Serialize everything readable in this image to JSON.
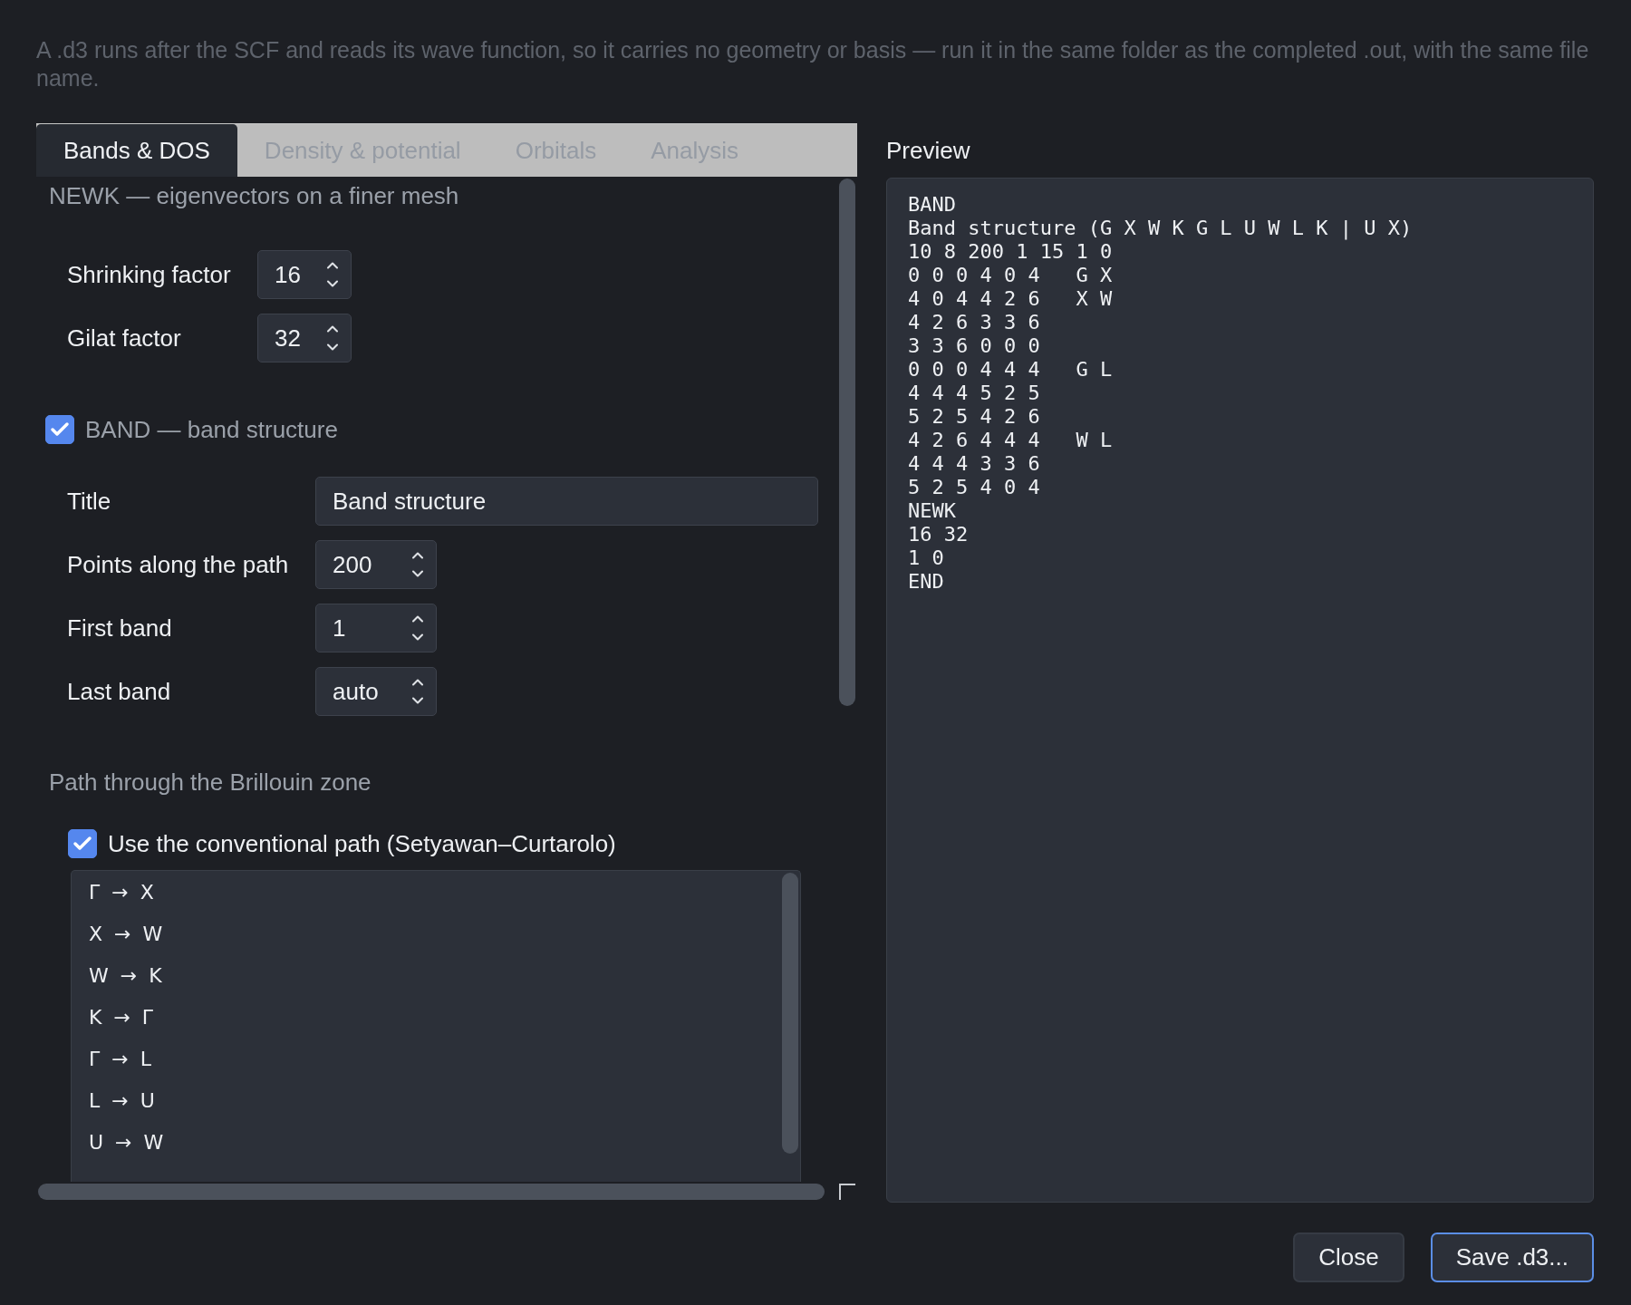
{
  "intro": "A .d3 runs after the SCF and reads its wave function, so it carries no geometry or basis — run it in the same folder as the completed .out, with the same file name.",
  "tabs": [
    {
      "label": "Bands & DOS",
      "selected": true
    },
    {
      "label": "Density & potential",
      "selected": false
    },
    {
      "label": "Orbitals",
      "selected": false
    },
    {
      "label": "Analysis",
      "selected": false
    }
  ],
  "newk": {
    "heading": "NEWK — eigenvectors on a finer mesh",
    "fields": [
      {
        "kind": "spin",
        "label": "Shrinking factor",
        "value": "16"
      },
      {
        "kind": "spin",
        "label": "Gilat factor",
        "value": "32"
      }
    ]
  },
  "band": {
    "checked": true,
    "label": "BAND — band structure",
    "fields": [
      {
        "kind": "text",
        "label": "Title",
        "value": "Band structure"
      },
      {
        "kind": "spin",
        "label": "Points along the path",
        "value": "200"
      },
      {
        "kind": "spin",
        "label": "First band",
        "value": "1"
      },
      {
        "kind": "spin",
        "label": "Last band",
        "value": "auto"
      }
    ]
  },
  "path": {
    "heading": "Path through the Brillouin zone",
    "conventional": {
      "checked": true,
      "label": "Use the conventional path (Setyawan–Curtarolo)"
    },
    "segments": [
      "Γ → X",
      "X → W",
      "W → K",
      "K → Γ",
      "Γ → L",
      "L → U",
      "U → W"
    ]
  },
  "preview": {
    "label": "Preview",
    "lines": [
      "BAND",
      "Band structure (G X W K G L U W L K | U X)",
      "10 8 200 1 15 1 0",
      "0 0 0 4 0 4   G X",
      "4 0 4 4 2 6   X W",
      "4 2 6 3 3 6",
      "3 3 6 0 0 0",
      "0 0 0 4 4 4   G L",
      "4 4 4 5 2 5",
      "5 2 5 4 2 6",
      "4 2 6 4 4 4   W L",
      "4 4 4 3 3 6",
      "5 2 5 4 0 4",
      "NEWK",
      "16 32",
      "1 0",
      "END"
    ]
  },
  "buttons": [
    {
      "label": "Close",
      "kind": "default"
    },
    {
      "label": "Save .d3...",
      "kind": "primary"
    }
  ]
}
